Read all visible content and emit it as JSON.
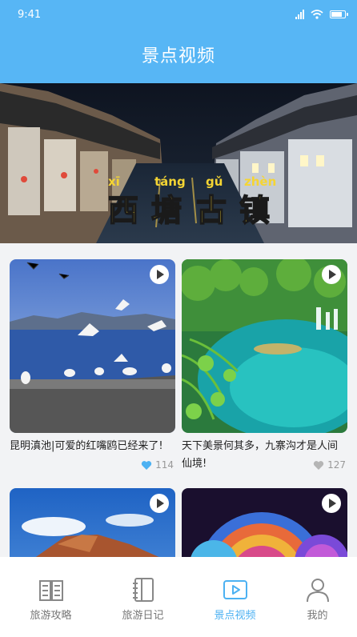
{
  "status_bar": {
    "time": "9:41"
  },
  "header": {
    "title": "景点视频"
  },
  "banner": {
    "pinyin": [
      "xī",
      "táng",
      "gǔ",
      "zhèn"
    ],
    "characters": [
      "西",
      "塘",
      "古",
      "镇"
    ]
  },
  "videos": [
    {
      "title": "昆明滇池|可爱的红嘴鸥已经来了!",
      "likes": "114",
      "liked": true
    },
    {
      "title": "天下美景何其多，九寨沟才是人间仙境!",
      "likes": "127",
      "liked": false
    },
    {
      "title": "",
      "likes": "",
      "liked": false
    },
    {
      "title": "",
      "likes": "",
      "liked": false
    }
  ],
  "tabs": [
    {
      "label": "旅游攻略",
      "icon": "book-icon"
    },
    {
      "label": "旅游日记",
      "icon": "notebook-icon"
    },
    {
      "label": "景点视频",
      "icon": "video-play-icon",
      "active": true
    },
    {
      "label": "我的",
      "icon": "user-icon"
    }
  ],
  "colors": {
    "primary": "#57b6f5",
    "active_tab": "#4cb1f2",
    "liked_heart": "#4cb1f2",
    "unliked_heart": "#b5b5b5"
  }
}
